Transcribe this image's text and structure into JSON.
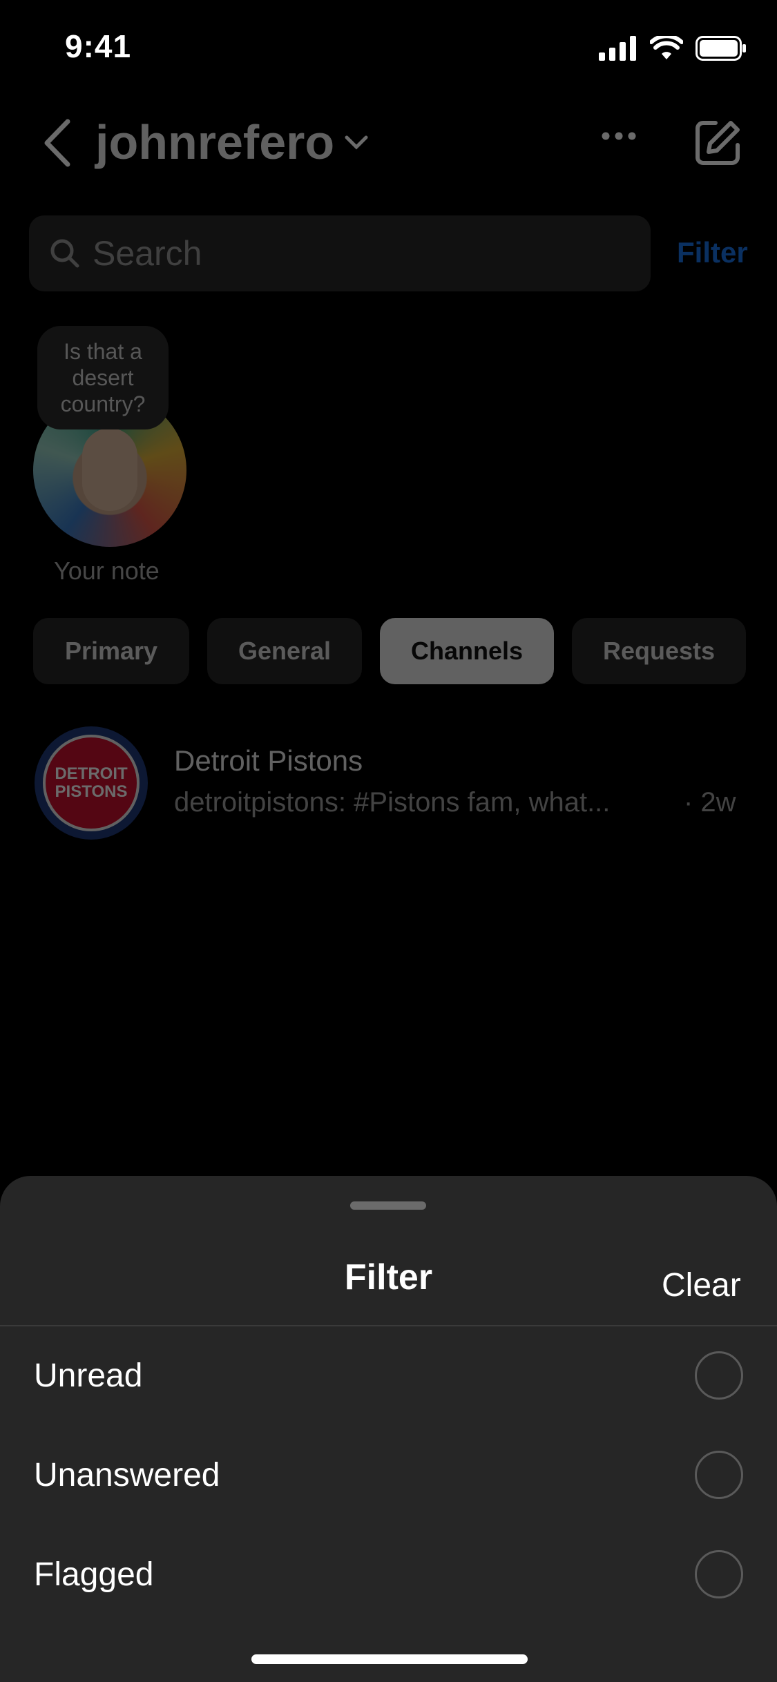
{
  "status_bar": {
    "time": "9:41"
  },
  "header": {
    "username": "johnrefero"
  },
  "search": {
    "placeholder": "Search",
    "filter_label": "Filter"
  },
  "note": {
    "bubble_text": "Is that a desert country?",
    "label": "Your note"
  },
  "tabs": [
    {
      "label": "Primary",
      "active": false
    },
    {
      "label": "General",
      "active": false
    },
    {
      "label": "Channels",
      "active": true
    },
    {
      "label": "Requests",
      "active": false
    }
  ],
  "channels": [
    {
      "name": "Detroit Pistons",
      "preview": "detroitpistons: #Pistons fam, what...",
      "time": "· 2w",
      "logo_text_line1": "DETROIT",
      "logo_text_line2": "PISTONS"
    }
  ],
  "filter_sheet": {
    "title": "Filter",
    "clear_label": "Clear",
    "options": [
      {
        "label": "Unread",
        "selected": false
      },
      {
        "label": "Unanswered",
        "selected": false
      },
      {
        "label": "Flagged",
        "selected": false
      }
    ]
  },
  "colors": {
    "accent": "#1a73e8",
    "sheet_bg": "#262626",
    "background": "#000000"
  }
}
